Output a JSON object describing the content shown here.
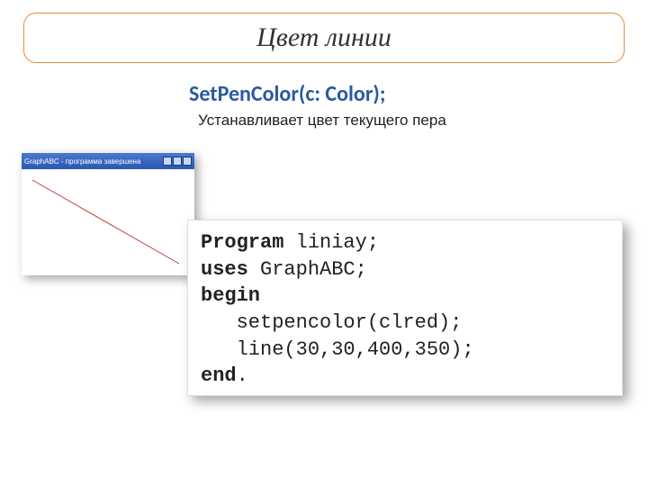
{
  "title": "Цвет линии",
  "signature": "SetPenColor(c: Color);",
  "description": "Устанавливает цвет текущего пера",
  "window": {
    "title": "GraphABC - программа завершена"
  },
  "code": {
    "l1_kw": "Program",
    "l1_rest": " liniay;",
    "l2_kw": "uses",
    "l2_rest": " GraphABC;",
    "l3_kw": "begin",
    "l4": "   setpencolor(clred);",
    "l5": "   line(30,30,400,350);",
    "l6_kw": "end",
    "l6_rest": "."
  }
}
